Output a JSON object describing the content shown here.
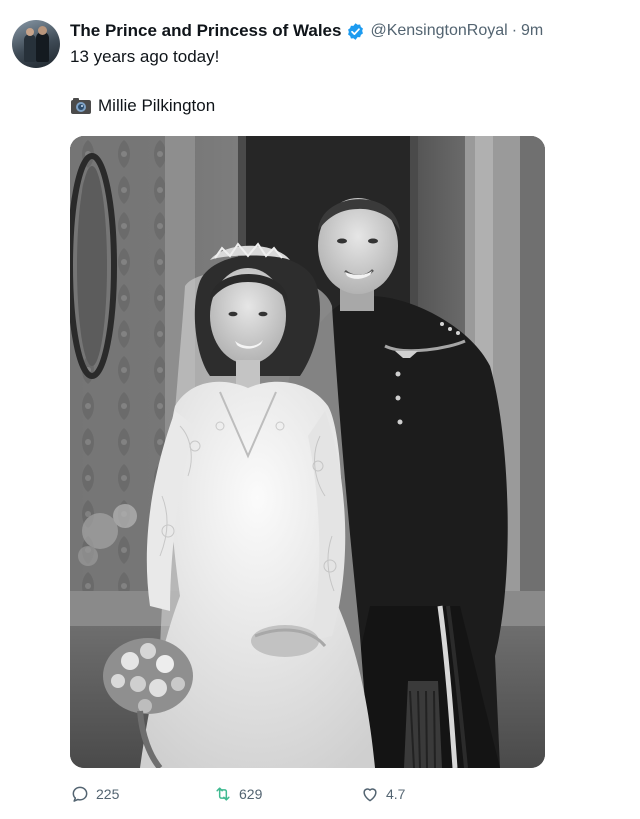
{
  "tweet": {
    "author_name": "The Prince and Princess of Wales",
    "handle": "@KensingtonRoyal",
    "separator": "·",
    "time": "9m",
    "text": "13 years ago today!",
    "photo_credit": "Millie Pilkington",
    "photo_subject": "wedding portrait",
    "stats": {
      "replies": "225",
      "retweets": "629",
      "likes": "4.7"
    }
  },
  "colors": {
    "verified": "#1d9bf0",
    "muted_text": "#536471",
    "text": "#0f1419"
  },
  "icons": [
    "verified-badge-icon",
    "camera-icon",
    "reply-icon",
    "retweet-icon",
    "like-icon"
  ]
}
